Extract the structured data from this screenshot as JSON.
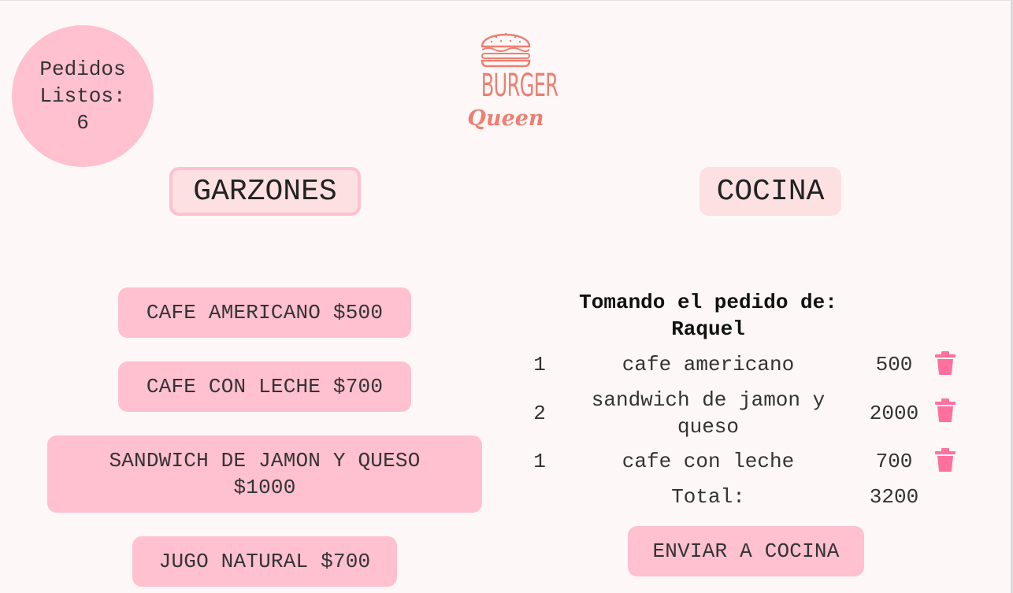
{
  "header": {
    "ready_orders_text": "Pedidos Listos: 6",
    "logo": {
      "line1": "BURGER",
      "line2": "Queen"
    }
  },
  "tabs": [
    {
      "label": "GARZONES"
    },
    {
      "label": "COCINA"
    }
  ],
  "menu": {
    "items": [
      {
        "label": "CAFE AMERICANO $500"
      },
      {
        "label": "CAFE CON LECHE $700"
      },
      {
        "label": "SANDWICH DE JAMON Y QUESO $1000"
      },
      {
        "label": "JUGO NATURAL $700"
      }
    ]
  },
  "order": {
    "header": "Tomando el pedido de: Raquel",
    "items": [
      {
        "qty": "1",
        "name": "cafe americano",
        "price": "500"
      },
      {
        "qty": "2",
        "name": "sandwich de jamon y queso",
        "price": "2000"
      },
      {
        "qty": "1",
        "name": "cafe con leche",
        "price": "700"
      }
    ],
    "total_label": "Total:",
    "total_value": "3200",
    "send_label": "ENVIAR A COCINA"
  },
  "colors": {
    "background": "#fdf8f7",
    "pink": "#ffc0cf",
    "tab_pink": "#fde0e2",
    "brand": "#ec7f72",
    "trash": "#ff6fa0"
  },
  "icons": {
    "logo": "burger-logo-icon",
    "delete": "trash-icon"
  }
}
